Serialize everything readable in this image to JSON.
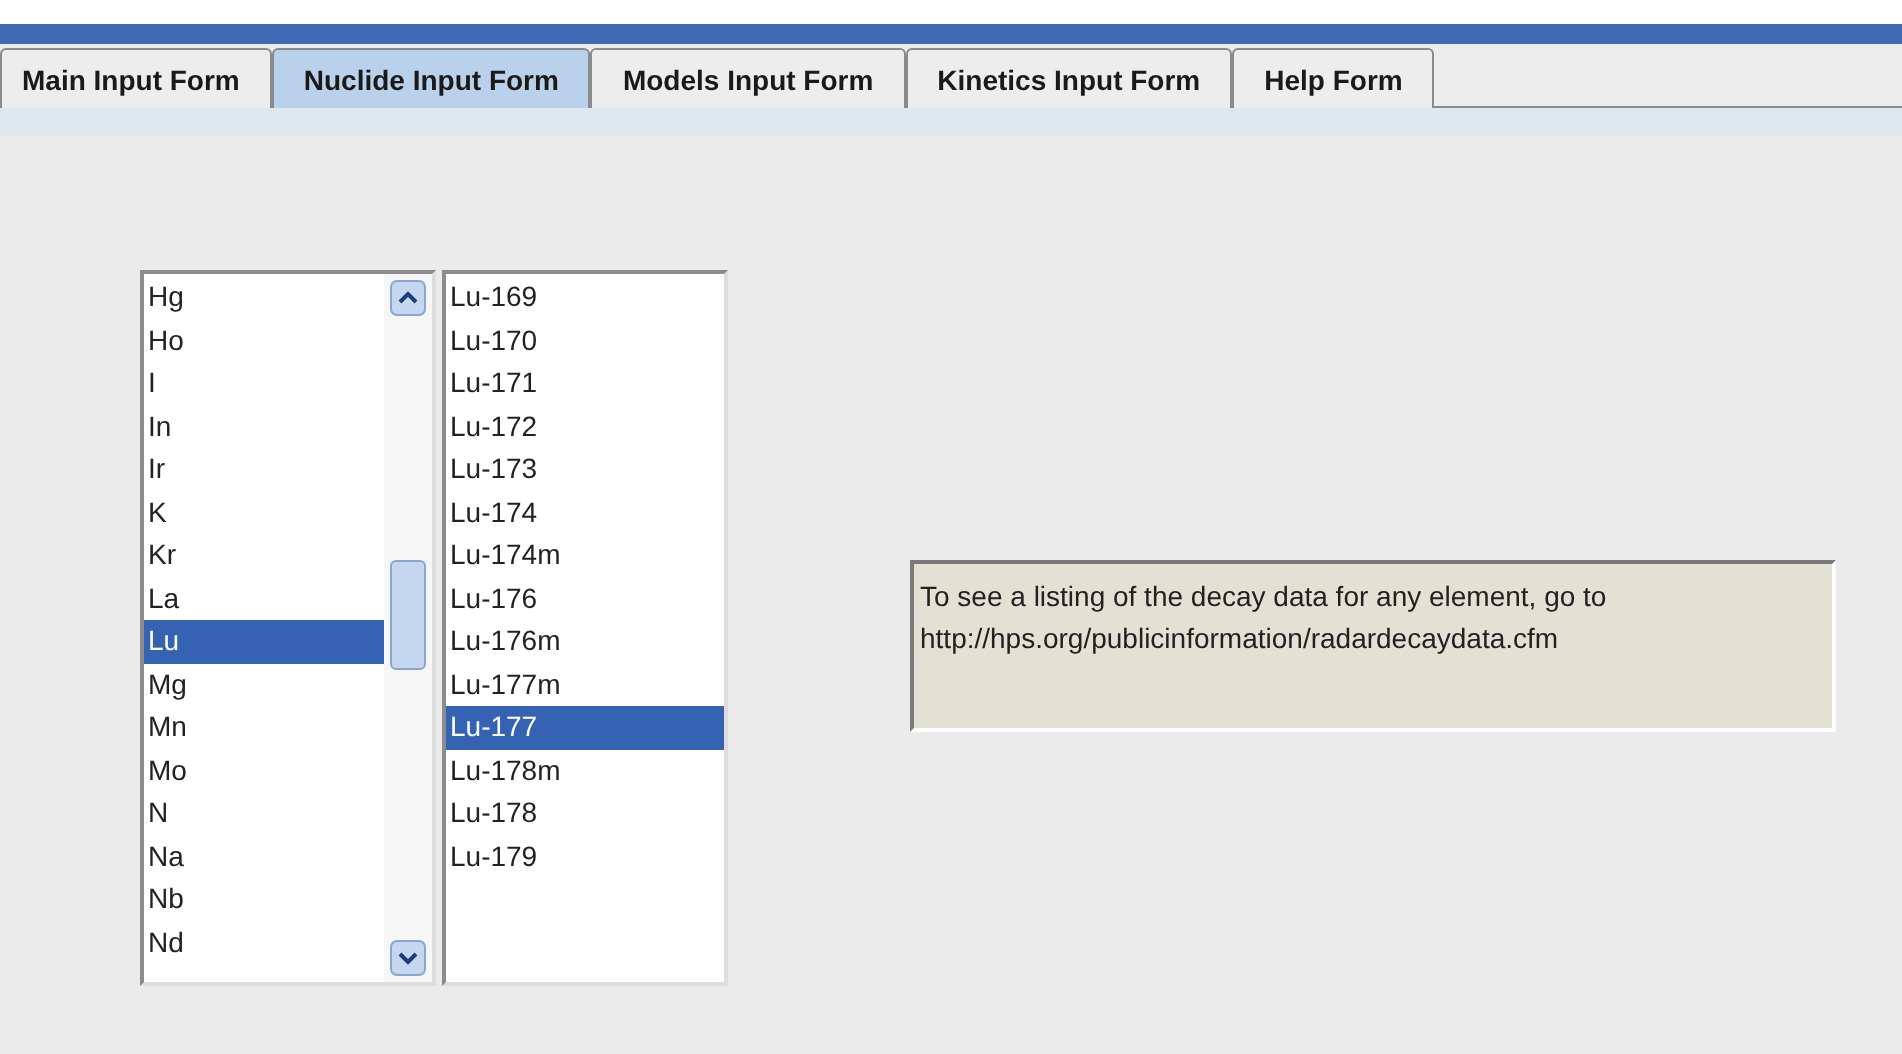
{
  "tabs": [
    {
      "label": "Main Input Form",
      "selected": false
    },
    {
      "label": "Nuclide Input Form",
      "selected": true
    },
    {
      "label": "Models Input Form",
      "selected": false
    },
    {
      "label": "Kinetics Input Form",
      "selected": false
    },
    {
      "label": "Help Form",
      "selected": false
    }
  ],
  "elements": [
    {
      "label": "Hg",
      "selected": false
    },
    {
      "label": "Ho",
      "selected": false
    },
    {
      "label": "I",
      "selected": false
    },
    {
      "label": "In",
      "selected": false
    },
    {
      "label": "Ir",
      "selected": false
    },
    {
      "label": "K",
      "selected": false
    },
    {
      "label": "Kr",
      "selected": false
    },
    {
      "label": "La",
      "selected": false
    },
    {
      "label": "Lu",
      "selected": true
    },
    {
      "label": "Mg",
      "selected": false
    },
    {
      "label": "Mn",
      "selected": false
    },
    {
      "label": "Mo",
      "selected": false
    },
    {
      "label": "N",
      "selected": false
    },
    {
      "label": "Na",
      "selected": false
    },
    {
      "label": "Nb",
      "selected": false
    },
    {
      "label": "Nd",
      "selected": false
    }
  ],
  "nuclides": [
    {
      "label": "Lu-169",
      "selected": false
    },
    {
      "label": "Lu-170",
      "selected": false
    },
    {
      "label": "Lu-171",
      "selected": false
    },
    {
      "label": "Lu-172",
      "selected": false
    },
    {
      "label": "Lu-173",
      "selected": false
    },
    {
      "label": "Lu-174",
      "selected": false
    },
    {
      "label": "Lu-174m",
      "selected": false
    },
    {
      "label": "Lu-176",
      "selected": false
    },
    {
      "label": "Lu-176m",
      "selected": false
    },
    {
      "label": "Lu-177m",
      "selected": false
    },
    {
      "label": "Lu-177",
      "selected": true
    },
    {
      "label": "Lu-178m",
      "selected": false
    },
    {
      "label": "Lu-178",
      "selected": false
    },
    {
      "label": "Lu-179",
      "selected": false
    }
  ],
  "info": {
    "text": "To see a listing of the decay data for any element, go to http://hps.org/publicinformation/radardecaydata.cfm"
  }
}
